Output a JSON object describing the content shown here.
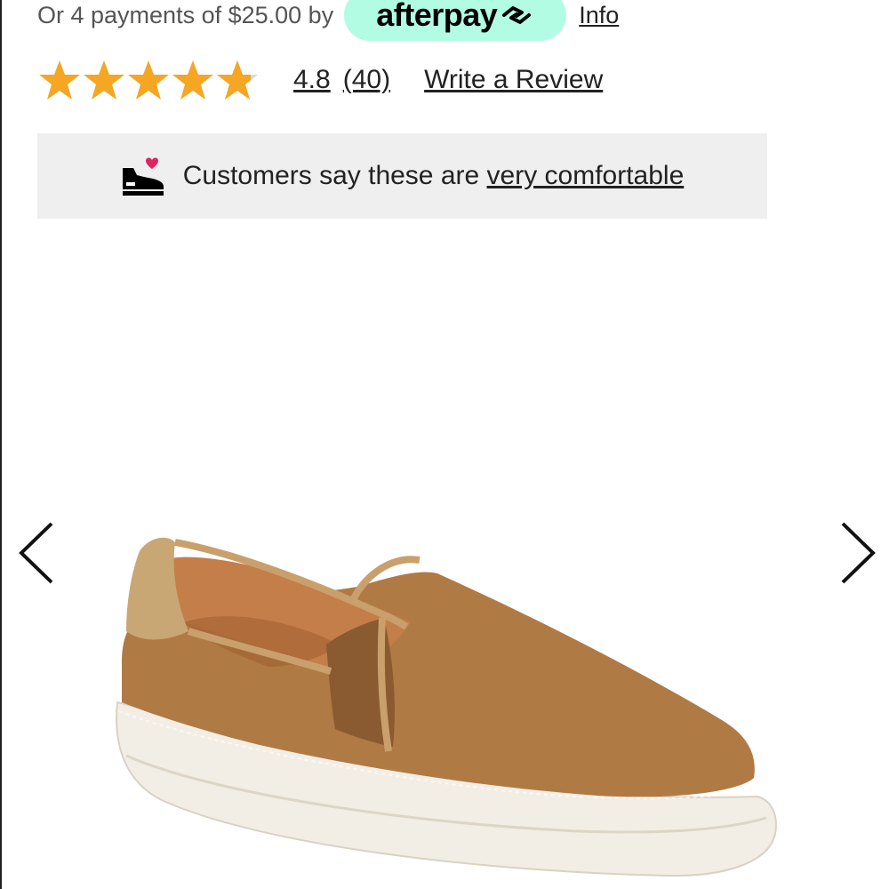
{
  "payment": {
    "text": "Or 4 payments of $25.00 by",
    "provider": "afterpay",
    "info_label": "Info",
    "badge_color": "#b2fce4"
  },
  "rating": {
    "value": "4.8",
    "count": "(40)",
    "stars_filled": 4.8,
    "stars_total": 5,
    "star_color": "#f5a623",
    "write_review_label": "Write a Review"
  },
  "comfort_banner": {
    "prefix": "Customers say these are ",
    "link_text": "very comfortable",
    "icon": "shoe-heart-icon",
    "heart_color": "#e0245e"
  },
  "carousel": {
    "prev_icon": "chevron-left-icon",
    "next_icon": "chevron-right-icon",
    "product_image": "tan-suede-slip-on-sneaker"
  }
}
